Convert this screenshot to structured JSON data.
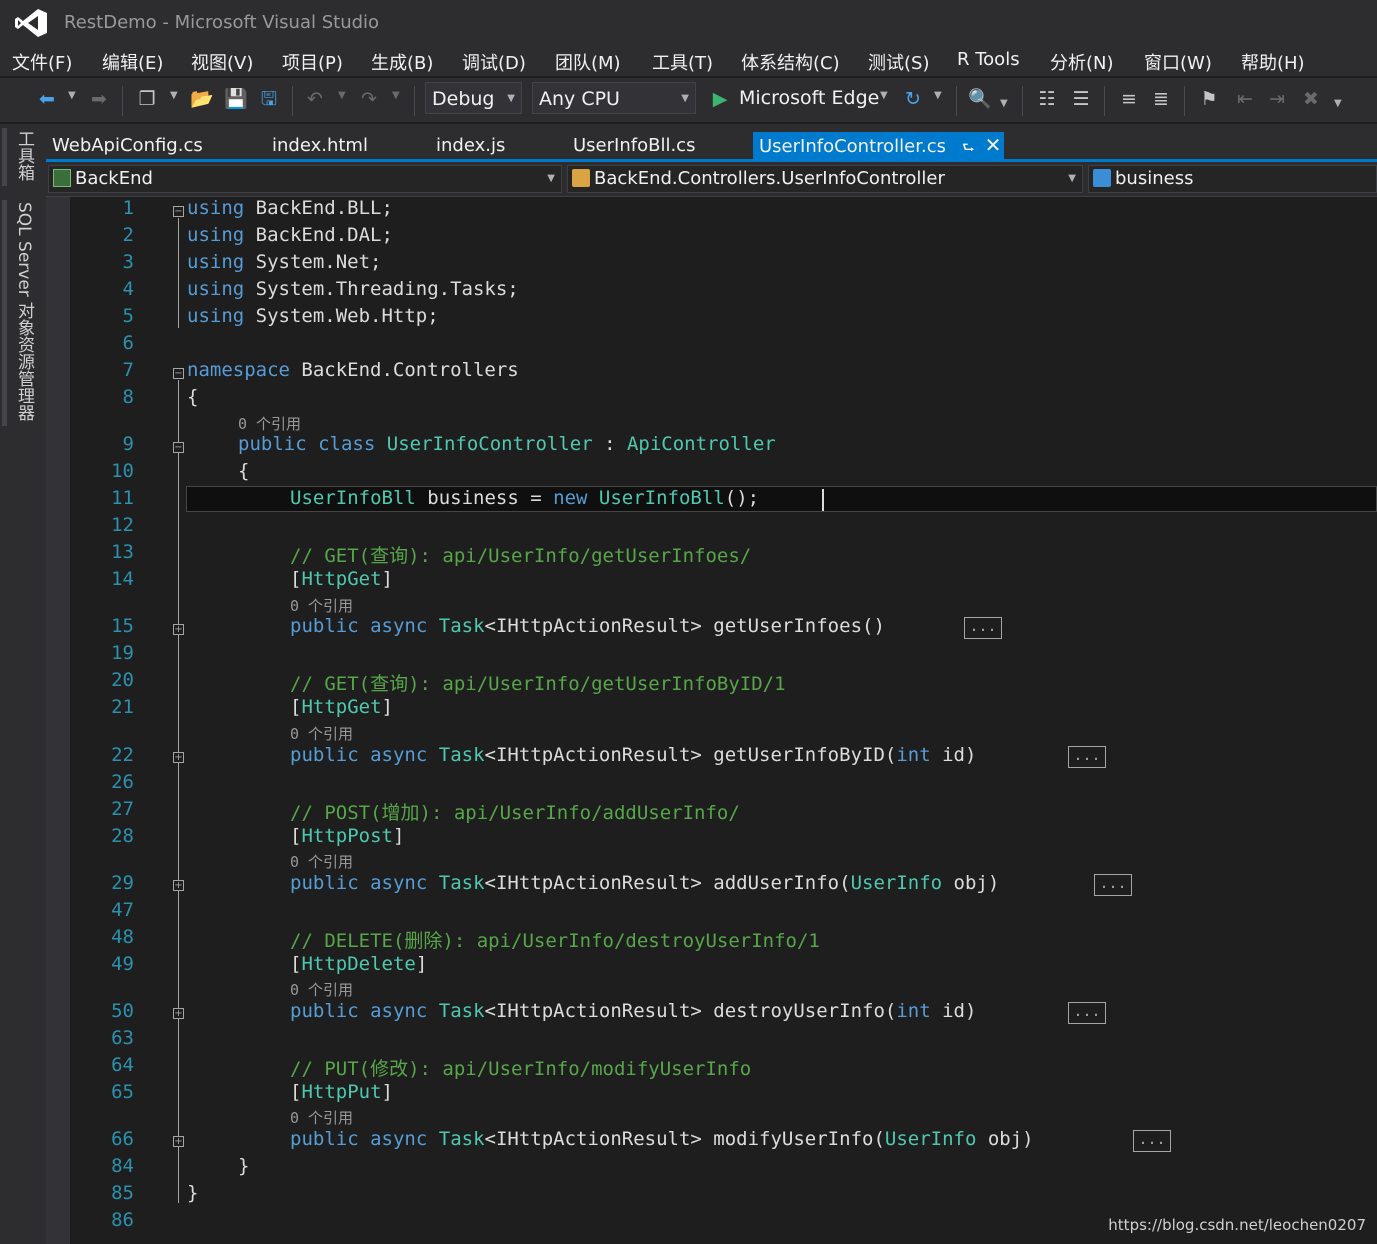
{
  "window": {
    "title": "RestDemo - Microsoft Visual Studio"
  },
  "menu": [
    "文件(F)",
    "编辑(E)",
    "视图(V)",
    "项目(P)",
    "生成(B)",
    "调试(D)",
    "团队(M)",
    "工具(T)",
    "体系结构(C)",
    "测试(S)",
    "R Tools",
    "分析(N)",
    "窗口(W)",
    "帮助(H)"
  ],
  "toolbar": {
    "configuration": "Debug",
    "platform": "Any CPU",
    "run_target": "Microsoft Edge",
    "run_icon": "play-icon"
  },
  "side_panels": [
    "工具箱",
    "SQL Server 对象资源管理器"
  ],
  "tabs": [
    "WebApiConfig.cs",
    "index.html",
    "index.js",
    "UserInfoBll.cs",
    "UserInfoController.cs"
  ],
  "active_tab": "UserInfoController.cs",
  "navbar": {
    "project": "BackEnd",
    "class": "BackEnd.Controllers.UserInfoController",
    "member": "business"
  },
  "code": {
    "line_numbers": [
      "1",
      "2",
      "3",
      "4",
      "5",
      "6",
      "7",
      "8",
      "9",
      "10",
      "11",
      "12",
      "13",
      "14",
      "15",
      "19",
      "20",
      "21",
      "22",
      "26",
      "27",
      "28",
      "29",
      "47",
      "48",
      "49",
      "50",
      "63",
      "64",
      "65",
      "66",
      "84",
      "85",
      "86"
    ],
    "references": "0 个引用",
    "collapsed_marker": "...",
    "lines": {
      "l1": {
        "kw": "using",
        "text": " BackEnd.BLL;"
      },
      "l2": {
        "kw": "using",
        "text": " BackEnd.DAL;"
      },
      "l3": {
        "kw": "using",
        "text": " System.Net;"
      },
      "l4": {
        "kw": "using",
        "text": " System.Threading.Tasks;"
      },
      "l5": {
        "kw": "using",
        "text": " System.Web.Http;"
      },
      "l7": {
        "kw": "namespace",
        "text": " BackEnd.Controllers"
      },
      "l8": {
        "text": "{"
      },
      "l9": {
        "kw1": "public",
        "kw2": "class",
        "type": "UserInfoController",
        "sep": " : ",
        "base": "ApiController"
      },
      "l10": {
        "text": "{"
      },
      "l11": {
        "type": "UserInfoBll",
        "name": " business ",
        "op": "=",
        "kw": "new",
        "ctor": "UserInfoBll",
        "tail": "();"
      },
      "l13": {
        "comment": "// GET(查询): api/UserInfo/getUserInfoes/"
      },
      "l14": {
        "open": "[",
        "attr": "HttpGet",
        "close": "]"
      },
      "l15": {
        "kw1": "public",
        "kw2": "async",
        "type": "Task",
        "sig": "<IHttpActionResult> getUserInfoes()"
      },
      "l20": {
        "comment": "// GET(查询): api/UserInfo/getUserInfoByID/1"
      },
      "l21": {
        "open": "[",
        "attr": "HttpGet",
        "close": "]"
      },
      "l22": {
        "kw1": "public",
        "kw2": "async",
        "type": "Task",
        "sig": "<IHttpActionResult> getUserInfoByID(",
        "pkw": "int",
        "ptail": " id)"
      },
      "l27": {
        "comment": "// POST(增加): api/UserInfo/addUserInfo/"
      },
      "l28": {
        "open": "[",
        "attr": "HttpPost",
        "close": "]"
      },
      "l29": {
        "kw1": "public",
        "kw2": "async",
        "type": "Task",
        "sig": "<IHttpActionResult> addUserInfo(",
        "ptype": "UserInfo",
        "ptail": " obj)"
      },
      "l48": {
        "comment": "// DELETE(删除): api/UserInfo/destroyUserInfo/1"
      },
      "l49": {
        "open": "[",
        "attr": "HttpDelete",
        "close": "]"
      },
      "l50": {
        "kw1": "public",
        "kw2": "async",
        "type": "Task",
        "sig": "<IHttpActionResult> destroyUserInfo(",
        "pkw": "int",
        "ptail": " id)"
      },
      "l64": {
        "comment": "// PUT(修改): api/UserInfo/modifyUserInfo"
      },
      "l65": {
        "open": "[",
        "attr": "HttpPut",
        "close": "]"
      },
      "l66": {
        "kw1": "public",
        "kw2": "async",
        "type": "Task",
        "sig": "<IHttpActionResult> modifyUserInfo(",
        "ptype": "UserInfo",
        "ptail": " obj)"
      },
      "l84": {
        "text": "}"
      },
      "l85": {
        "text": "}"
      }
    }
  },
  "watermark": "https://blog.csdn.net/leochen0207"
}
